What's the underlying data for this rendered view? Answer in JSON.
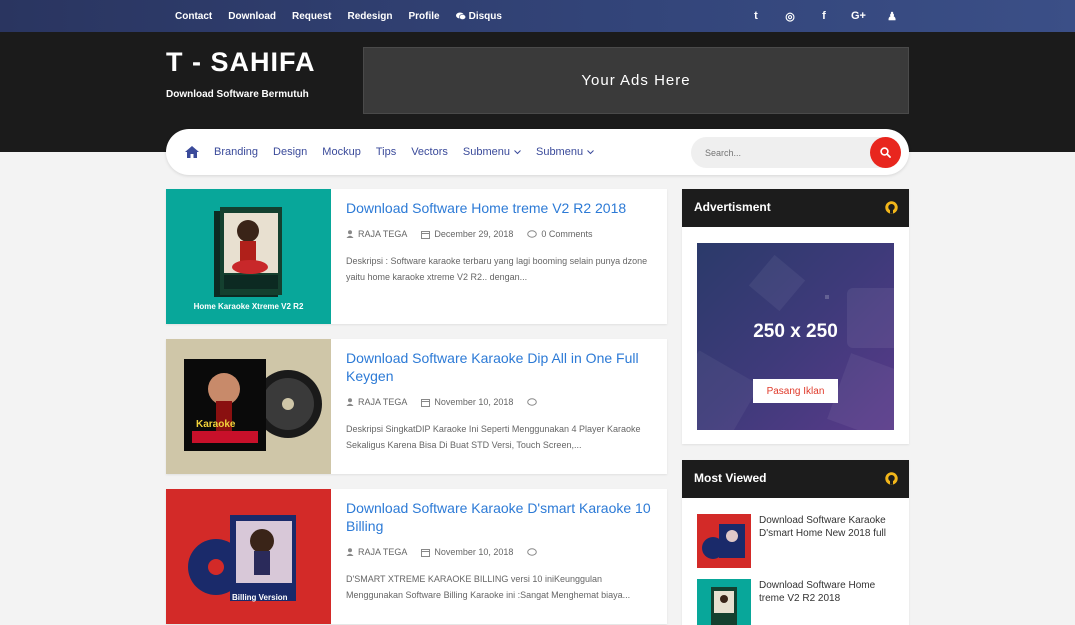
{
  "topbar": {
    "links": [
      "Contact",
      "Download",
      "Request",
      "Redesign",
      "Profile",
      "Disqus"
    ],
    "social_icons": [
      "twitter-icon",
      "instagram-icon",
      "facebook-icon",
      "google-plus-icon",
      "user-icon"
    ],
    "social_glyphs": [
      "t",
      "◎",
      "f",
      "G+",
      "♟"
    ]
  },
  "header": {
    "site_title": "T - SAHIFA",
    "tagline": "Download Software Bermutuh",
    "ads_text": "Your Ads Here"
  },
  "nav": {
    "items": [
      "Branding",
      "Design",
      "Mockup",
      "Tips",
      "Vectors",
      "Submenu",
      "Submenu"
    ],
    "search_placeholder": "Search..."
  },
  "posts": [
    {
      "title": "Download Software Home treme V2 R2 2018",
      "author": "RAJA TEGA",
      "date": "December 29, 2018",
      "comments": "0 Comments",
      "description": "Deskripsi : Software karaoke terbaru yang lagi booming selain punya dzone yaitu home karaoke xtreme V2 R2.. dengan...",
      "thumb_caption": "Home Karaoke Xtreme V2 R2",
      "thumb_color": "#08a79a"
    },
    {
      "title": "Download Software Karaoke Dip All in One Full Keygen",
      "author": "RAJA TEGA",
      "date": "November 10, 2018",
      "comments": "",
      "description": "Deskripsi SingkatDIP Karaoke Ini Seperti Menggunakan 4 Player Karaoke Sekaligus Karena Bisa Di Buat STD Versi, Touch Screen,...",
      "thumb_caption": "Karaoke",
      "thumb_color": "#cfc6a8"
    },
    {
      "title": "Download Software Karaoke D'smart Karaoke 10 Billing",
      "author": "RAJA TEGA",
      "date": "November 10, 2018",
      "comments": "",
      "description": "D'SMART XTREME KARAOKE BILLING versi 10 iniKeunggulan Menggunakan Software Billing Karaoke ini :Sangat Menghemat biaya...",
      "thumb_caption": "Billing Version",
      "thumb_color": "#d32a28"
    }
  ],
  "sidebar": {
    "advertisment": {
      "title": "Advertisment",
      "size_text": "250 x 250",
      "button_label": "Pasang Iklan"
    },
    "most_viewed": {
      "title": "Most Viewed",
      "items": [
        {
          "title": "Download Software Karaoke D'smart Home New 2018 full",
          "thumb_color": "#d32a28"
        },
        {
          "title": "Download Software Home treme V2 R2 2018",
          "thumb_color": "#08a79a"
        }
      ]
    }
  },
  "colors": {
    "topbar": "#2f3d6f",
    "header": "#1b1b1b",
    "link_blue": "#2c7ad6",
    "nav_text": "#3a4a9a",
    "accent_red": "#e8261e",
    "github_yellow": "#f2b61a"
  }
}
